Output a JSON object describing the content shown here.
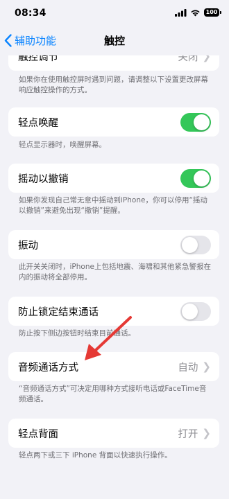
{
  "status": {
    "time": "08:34",
    "battery": "100"
  },
  "nav": {
    "back_label": "辅助功能",
    "title": "触控"
  },
  "rows": {
    "touch_adjust": {
      "label": "触控调节",
      "value": "关闭"
    },
    "tap_to_wake": {
      "label": "轻点唤醒",
      "toggle": "on"
    },
    "shake_to_undo": {
      "label": "摇动以撤销",
      "toggle": "on"
    },
    "vibration": {
      "label": "振动",
      "toggle": "off"
    },
    "prevent_lock_end_call": {
      "label": "防止锁定结束通话",
      "toggle": "off"
    },
    "call_audio_routing": {
      "label": "音频通话方式",
      "value": "自动"
    },
    "back_tap": {
      "label": "轻点背面",
      "value": "打开"
    }
  },
  "footers": {
    "touch_adjust": "如果你在使用触控屏时遇到问题，请调整以下设置更改屏幕响应触控操作的方式。",
    "tap_to_wake": "轻点显示器时，唤醒屏幕。",
    "shake_to_undo": "如果你发现自己常无意中摇动到iPhone，你可以停用“摇动以撤销”来避免出现“撤销”提醒。",
    "vibration": "此开关关闭时，iPhone上包括地震、海啸和其他紧急警报在内的振动将全部停用。",
    "prevent_lock_end_call": "防止按下侧边按钮时结束目前通话。",
    "call_audio_routing": "“音频通话方式”可决定用哪种方式接听电话或FaceTime音频通话。",
    "back_tap": "轻点两下或三下 iPhone 背面以快速执行操作。"
  },
  "colors": {
    "accent": "#0a84ff",
    "toggle_on": "#34c759",
    "annotation_arrow": "#e53935"
  },
  "icons": {
    "back": "chevron-left-icon",
    "disclosure": "chevron-right-icon",
    "annotation": "red-arrow"
  }
}
